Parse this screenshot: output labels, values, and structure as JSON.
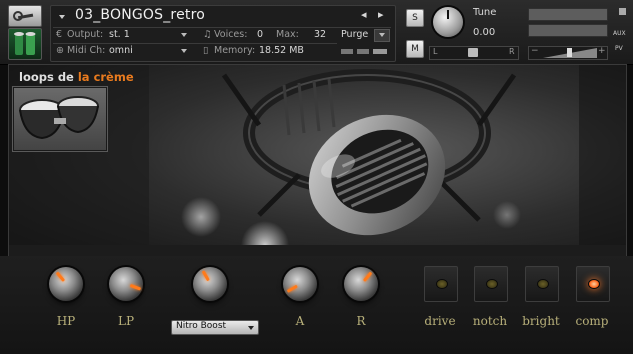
{
  "header": {
    "instrument_name": "03_BONGOS_retro",
    "output_label": "Output:",
    "output_value": "st. 1",
    "midi_label": "Midi Ch:",
    "midi_value": "omni",
    "voices_label": "Voices:",
    "voices_value": "0",
    "max_label": "Max:",
    "max_value": "32",
    "memory_label": "Memory:",
    "memory_value": "18.52 MB",
    "purge_label": "Purge",
    "solo_label": "S",
    "mute_label": "M",
    "tune_label": "Tune",
    "tune_value": "0.00",
    "pan_left": "L",
    "pan_right": "R",
    "vol_minus": "−",
    "vol_plus": "+",
    "aux_label": "AUX",
    "pv_label": "PV"
  },
  "logo": {
    "part1": "loops de ",
    "part2": "la crème"
  },
  "knobs": [
    {
      "label": "HP",
      "angle": -40
    },
    {
      "label": "LP",
      "angle": 110
    },
    {
      "label": "",
      "angle": -30
    },
    {
      "label": "A",
      "angle": -120
    },
    {
      "label": "R",
      "angle": 40
    }
  ],
  "dropdown": {
    "value": "Nitro Boost"
  },
  "fx_buttons": [
    {
      "label": "drive",
      "on": false
    },
    {
      "label": "notch",
      "on": false
    },
    {
      "label": "bright",
      "on": false
    },
    {
      "label": "comp",
      "on": true
    }
  ],
  "colors": {
    "accent": "#ff7a1a",
    "label": "#b8b07a",
    "logo_orange": "#e87a1e"
  }
}
